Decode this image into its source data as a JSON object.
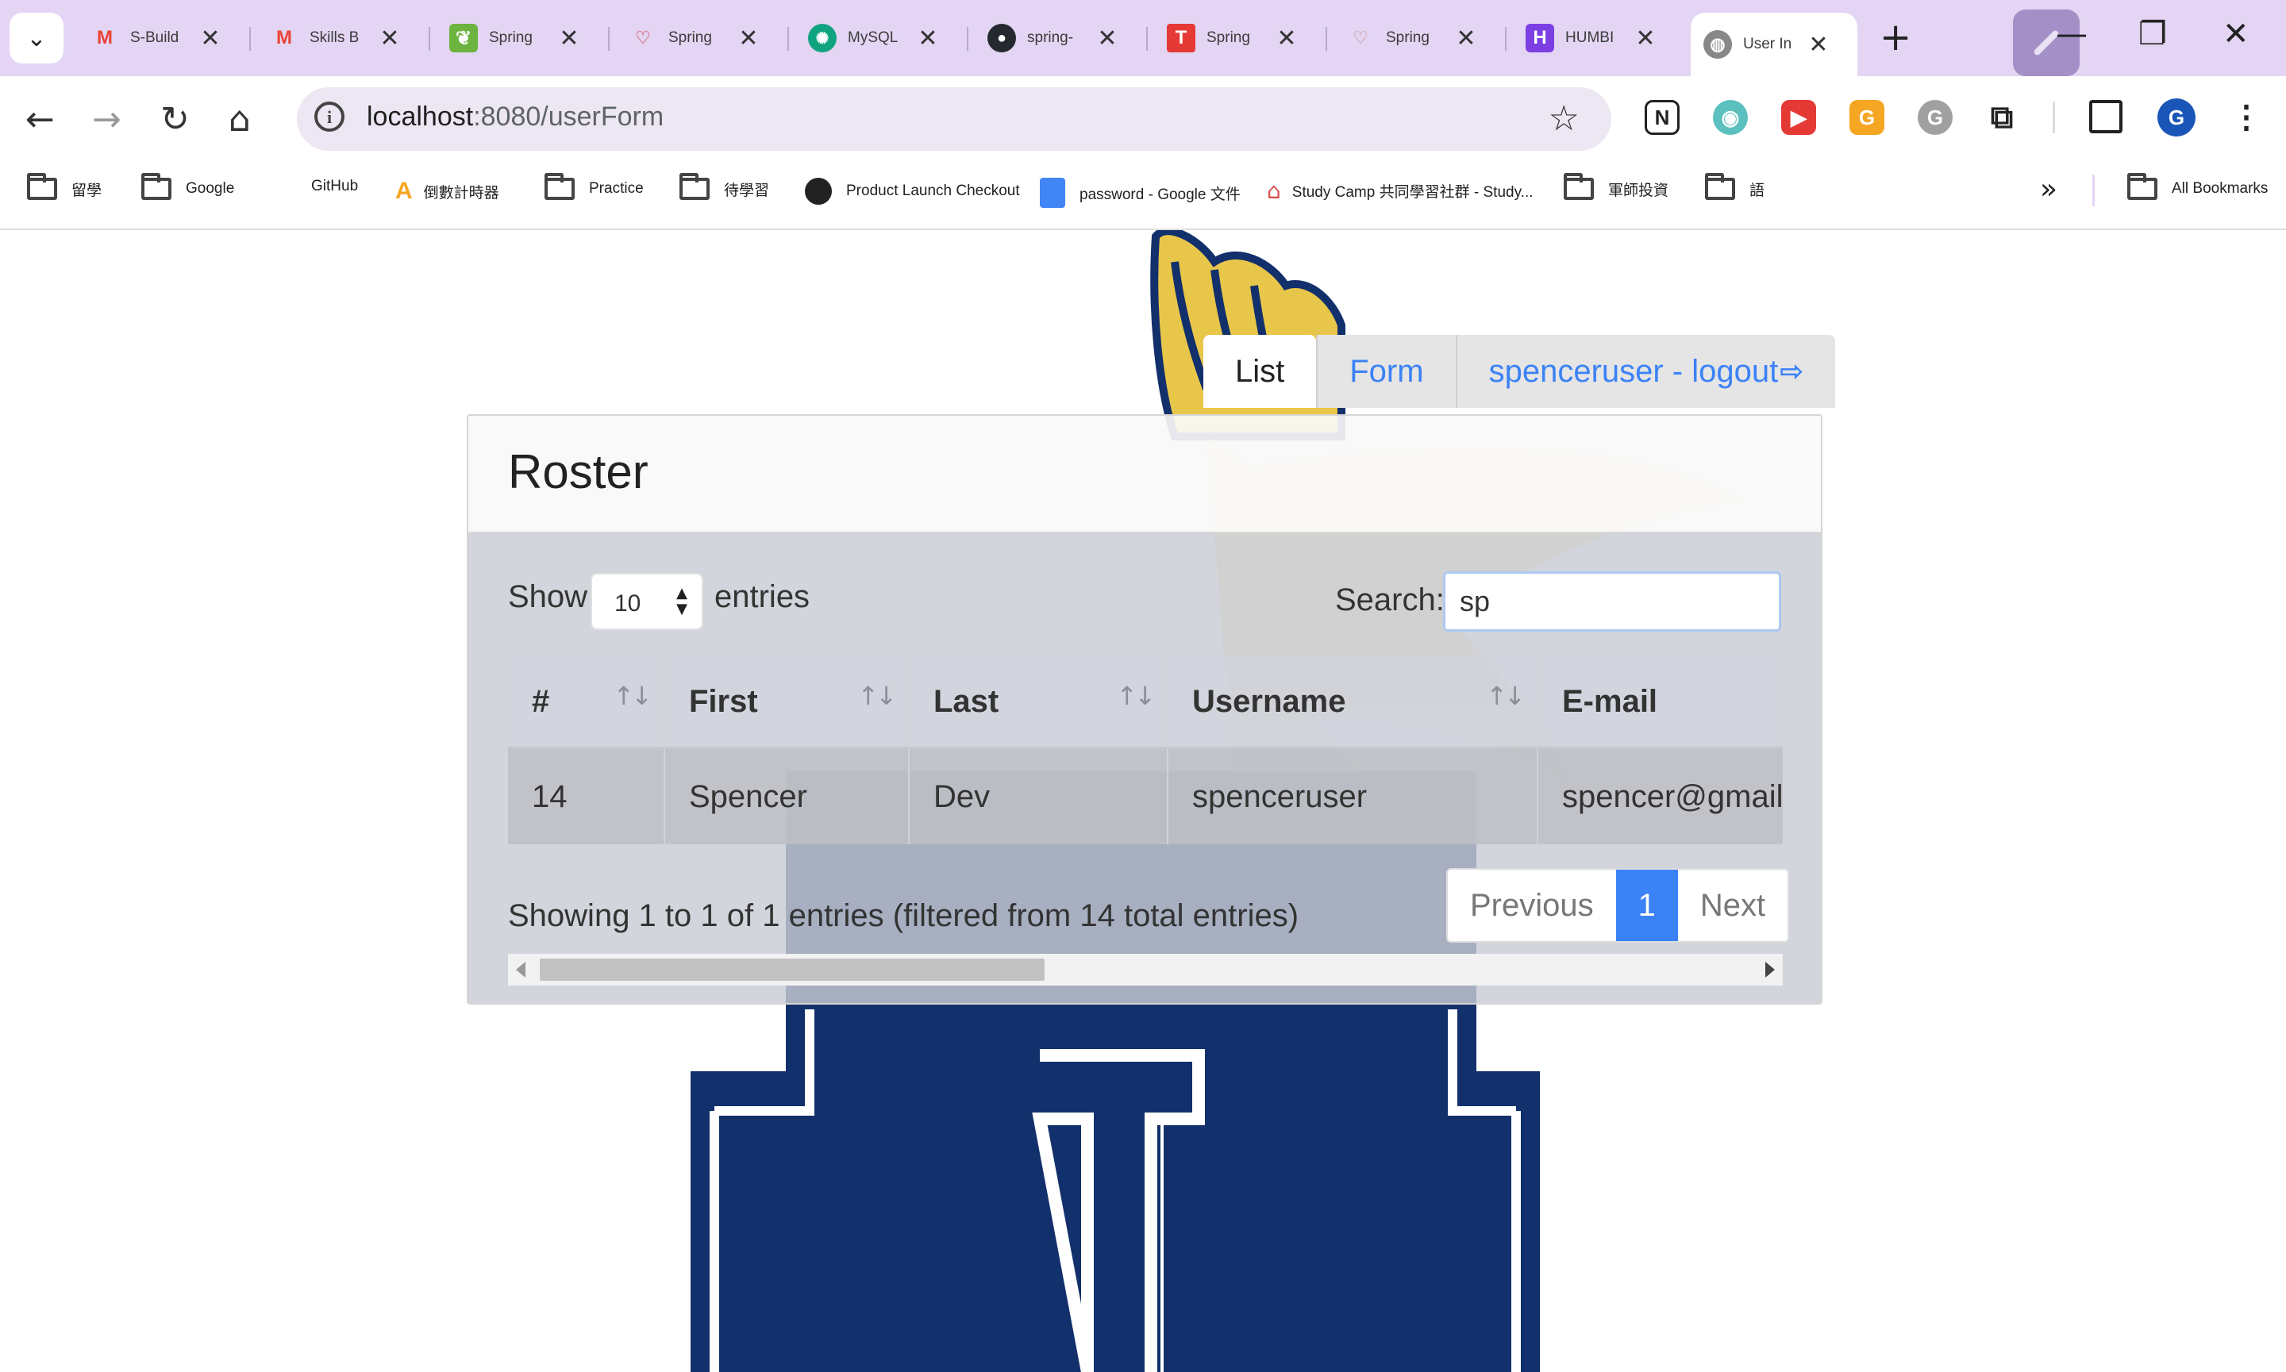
{
  "browser": {
    "tabs": [
      {
        "title": "S-Build",
        "icon": "gmail-icon",
        "color": "#ea4335"
      },
      {
        "title": "Skills B",
        "icon": "gmail-icon",
        "color": "#ea4335"
      },
      {
        "title": "Spring",
        "icon": "spring-leaf-icon",
        "color": "#6db33f"
      },
      {
        "title": "Spring",
        "icon": "spring-icon",
        "color": "#e0a0b8"
      },
      {
        "title": "MySQL",
        "icon": "chatgpt-icon",
        "color": "#10a37f"
      },
      {
        "title": "spring-",
        "icon": "github-icon",
        "color": "#24292f"
      },
      {
        "title": "Spring",
        "icon": "t-logo-icon",
        "color": "#e53935"
      },
      {
        "title": "Spring",
        "icon": "spring-icon",
        "color": "#e8d0dc"
      },
      {
        "title": "HUMBI",
        "icon": "humbi-icon",
        "color": "#7b3fe4"
      },
      {
        "title": "User In",
        "icon": "globe-icon",
        "color": "#555555"
      }
    ],
    "url_host": "localhost",
    "url_path": ":8080/userForm",
    "profile_initial": "G",
    "bookmarks": [
      "留學",
      "Google",
      "GitHub",
      "倒數計時器",
      "Practice",
      "待學習",
      "Product Launch Checkout",
      "password - Google 文件",
      "Study Camp 共同學習社群 - Study...",
      "軍師投資",
      "語"
    ],
    "all_bookmarks": "All Bookmarks"
  },
  "nav": {
    "list": "List",
    "form": "Form",
    "logout": "spenceruser - logout"
  },
  "roster": {
    "title": "Roster",
    "show_label": "Show",
    "page_length": "10",
    "entries_label": "entries",
    "search_label": "Search:",
    "search_value": "sp",
    "columns": [
      "#",
      "First",
      "Last",
      "Username",
      "E-mail"
    ],
    "rows": [
      [
        "14",
        "Spencer",
        "Dev",
        "spenceruser",
        "spencer@gmail.com"
      ]
    ],
    "info": "Showing 1 to 1 of 1 entries (filtered from 14 total entries)",
    "pagination": {
      "previous": "Previous",
      "current": "1",
      "next": "Next"
    },
    "scroll_position": 0.0
  },
  "colors": {
    "accent": "#3b82f6",
    "navy": "#12306b",
    "gold": "#e8c64a"
  }
}
